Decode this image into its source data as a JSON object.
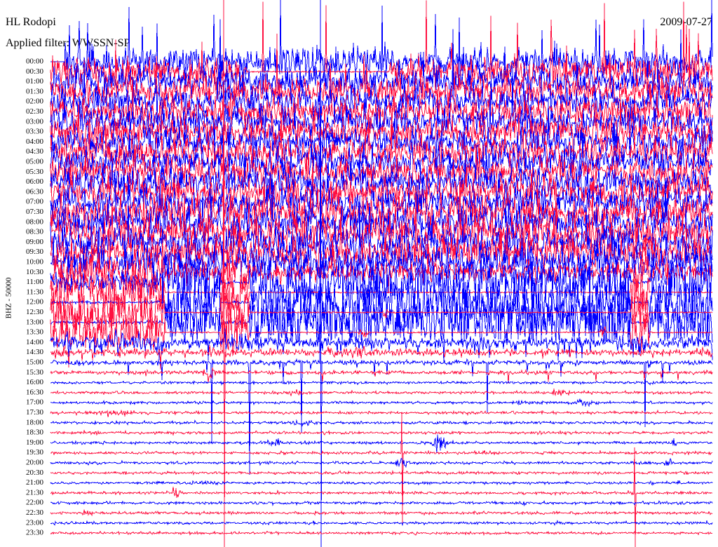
{
  "chart_data": {
    "type": "line",
    "title": "HL Rodopi",
    "date": "2009-07-27",
    "subtitle": "Applied filter: WWSSN-SP",
    "ylabel": "BHZ - 50000",
    "xlabel": "",
    "yticks": [
      "00:00",
      "00:30",
      "01:00",
      "01:30",
      "02:00",
      "02:30",
      "03:00",
      "03:30",
      "04:00",
      "04:30",
      "05:00",
      "05:30",
      "06:00",
      "06:30",
      "07:00",
      "07:30",
      "08:00",
      "08:30",
      "09:00",
      "09:30",
      "10:00",
      "10:30",
      "11:00",
      "11:30",
      "12:00",
      "12:30",
      "13:00",
      "13:30",
      "14:00",
      "14:30",
      "15:00",
      "15:30",
      "16:00",
      "16:30",
      "17:00",
      "17:30",
      "18:00",
      "18:30",
      "19:00",
      "19:30",
      "20:00",
      "20:30",
      "21:00",
      "21:30",
      "22:00",
      "22:30",
      "23:00",
      "23:30"
    ],
    "trace_colors": [
      "#0000ff",
      "#ff1040"
    ],
    "grid": false,
    "legend": "none"
  }
}
